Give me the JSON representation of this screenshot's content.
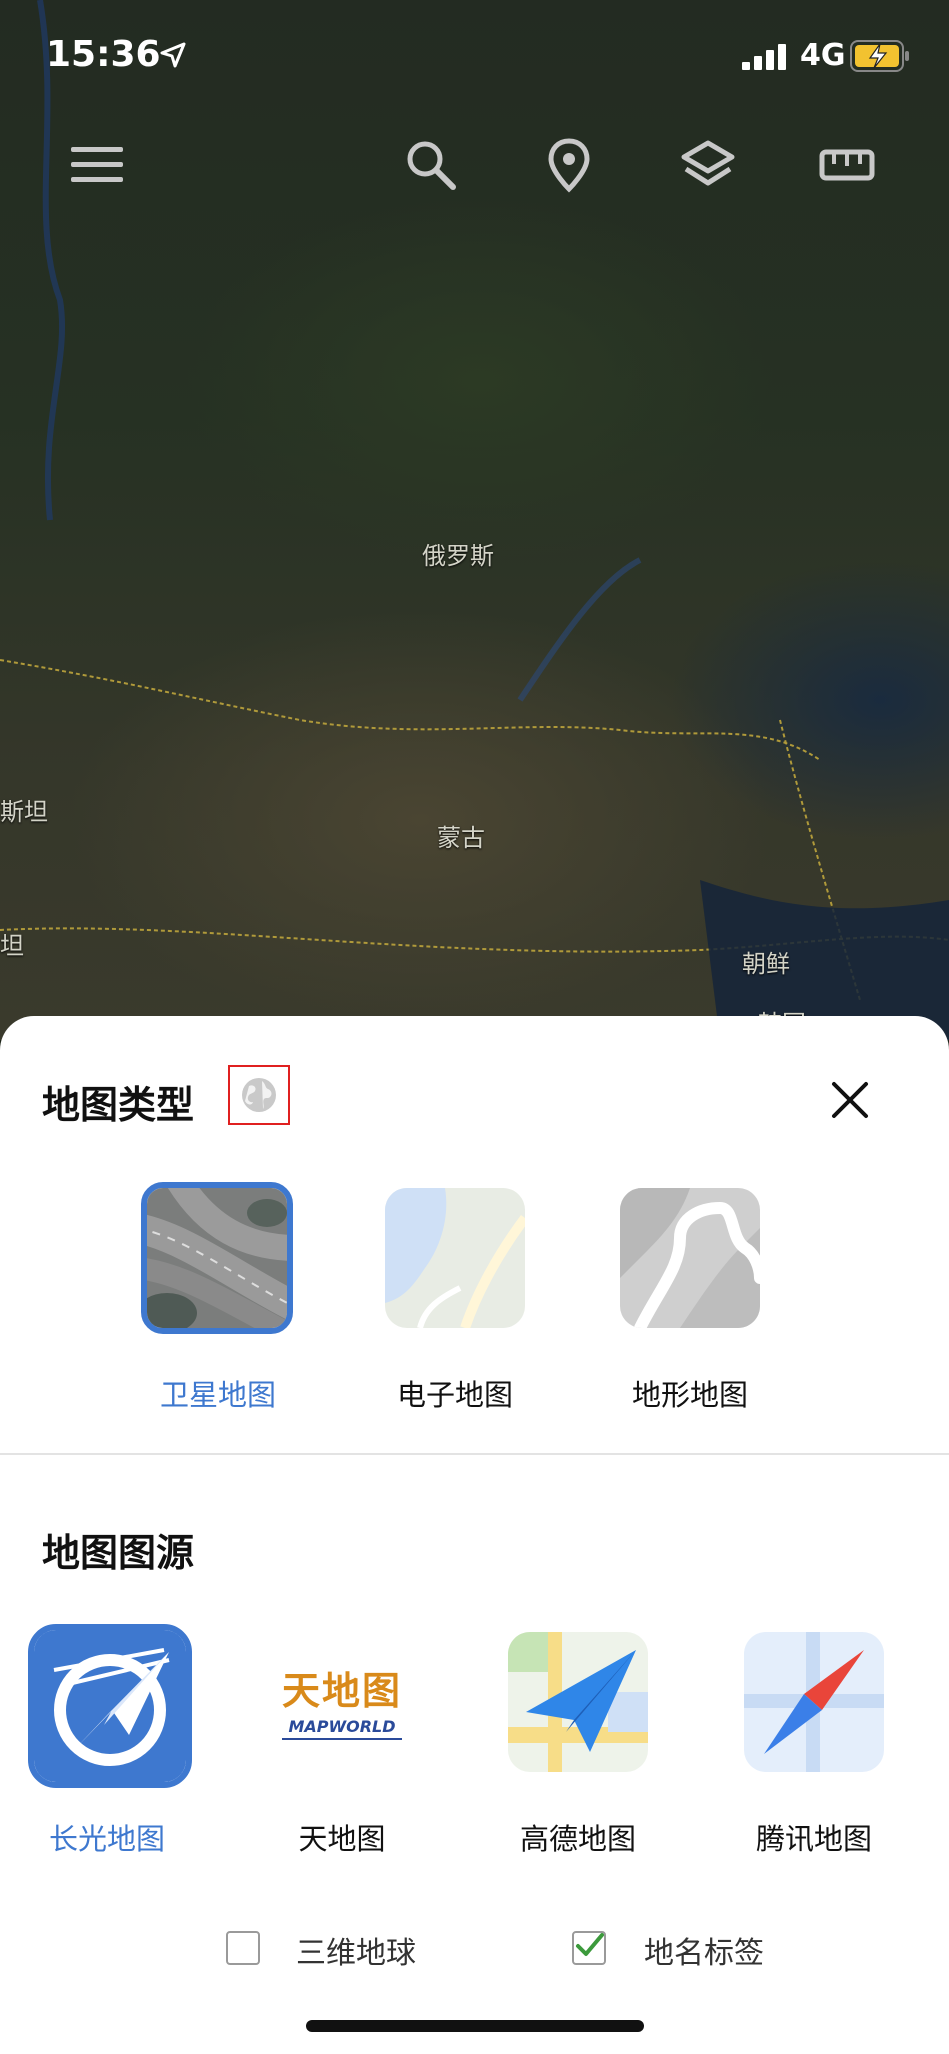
{
  "status_bar": {
    "time": "15:36",
    "network": "4G"
  },
  "map": {
    "labels": [
      "俄罗斯",
      "蒙古",
      "朝鲜",
      "斯坦",
      "坦",
      "韩国"
    ]
  },
  "toolbar": {
    "icons": [
      "menu-icon",
      "search-icon",
      "location-pin-icon",
      "layers-icon",
      "ruler-icon"
    ]
  },
  "sheet": {
    "map_type_title": "地图类型",
    "map_types": [
      {
        "label": "卫星地图",
        "selected": true
      },
      {
        "label": "电子地图",
        "selected": false
      },
      {
        "label": "地形地图",
        "selected": false
      }
    ],
    "map_source_title": "地图图源",
    "map_sources": [
      {
        "label": "长光地图",
        "selected": true
      },
      {
        "label": "天地图",
        "selected": false,
        "logo_text": "天地图",
        "logo_subtext": "MAPWORLD"
      },
      {
        "label": "高德地图",
        "selected": false
      },
      {
        "label": "腾讯地图",
        "selected": false
      }
    ],
    "options": [
      {
        "label": "三维地球",
        "checked": false
      },
      {
        "label": "地名标签",
        "checked": true
      }
    ]
  },
  "colors": {
    "accent": "#3e78cf",
    "check": "#3c9a3c"
  }
}
